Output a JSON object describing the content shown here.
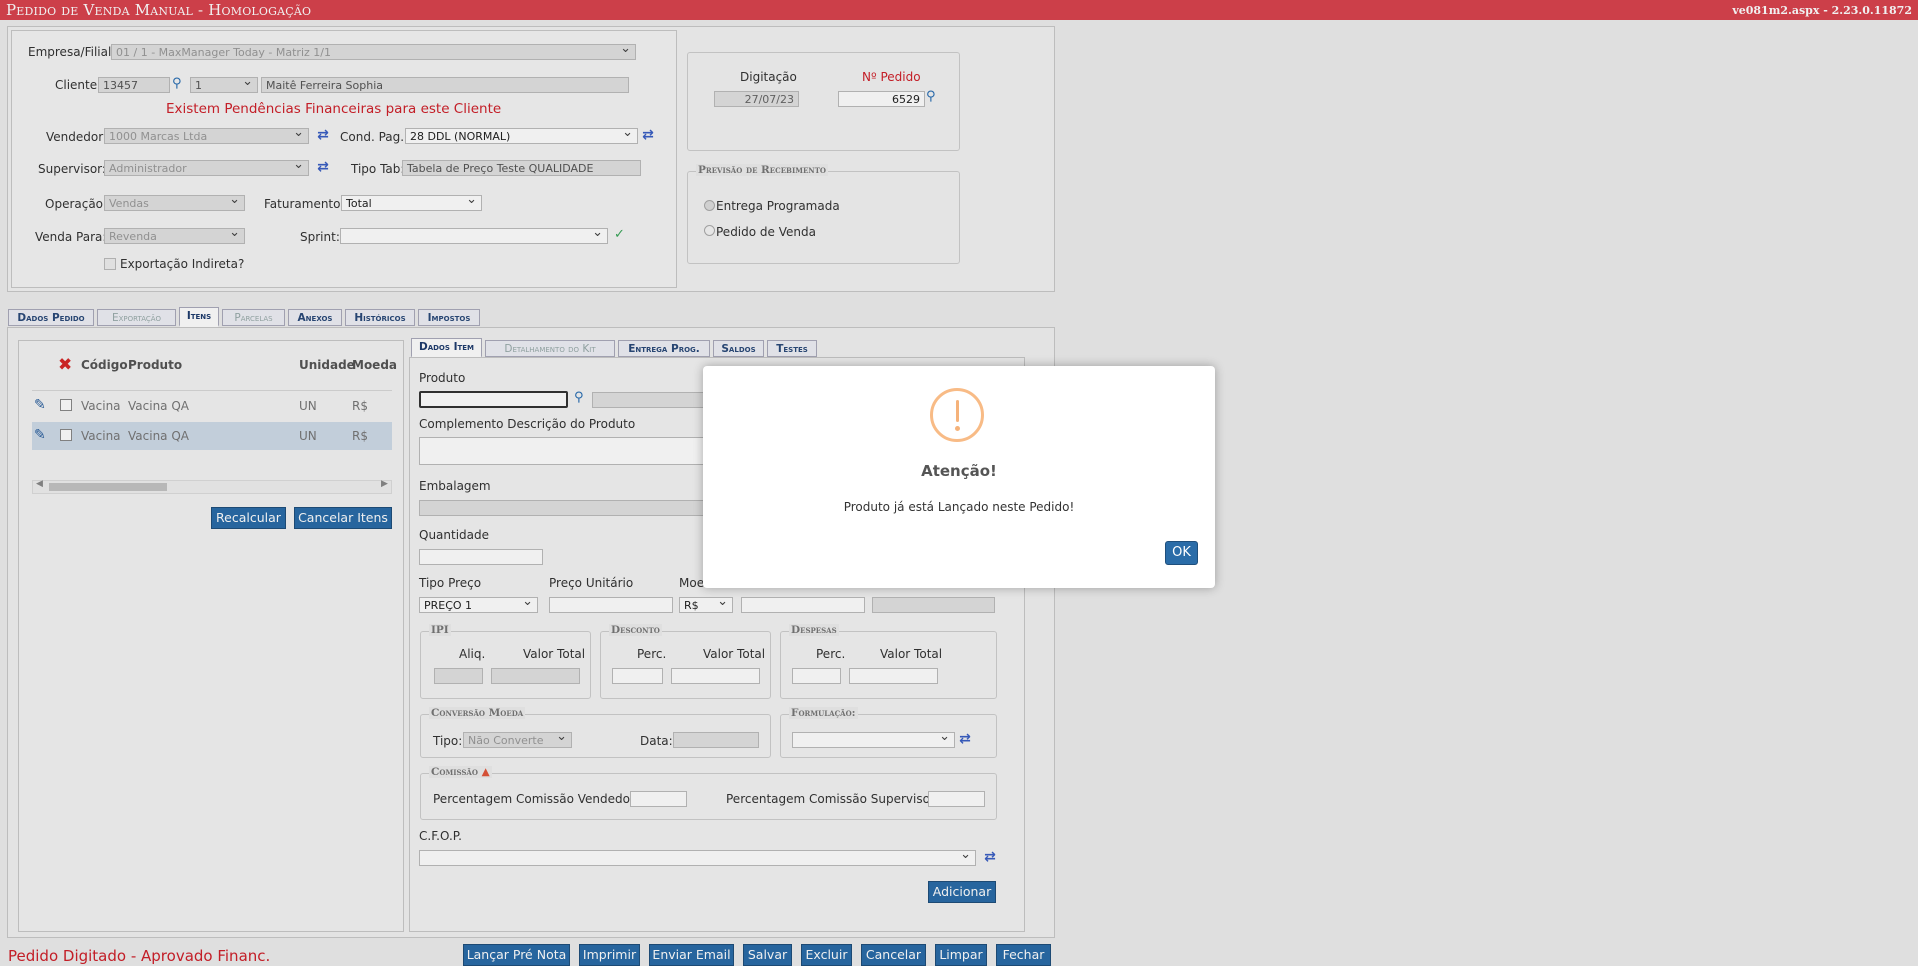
{
  "header": {
    "title": "Pedido de Venda Manual  - Homologação",
    "version": "ve081m2.aspx - 2.23.0.11872"
  },
  "form": {
    "empresa_label": "Empresa/Filial:",
    "empresa_value": "01 / 1 - MaxManager Today - Matriz 1/1",
    "cliente_label": "Cliente:",
    "cliente_code": "13457",
    "cliente_seq": "1",
    "cliente_name": "Maitê Ferreira Sophia",
    "pendencias_msg": "Existem Pendências Financeiras para este Cliente",
    "vendedor_label": "Vendedor:",
    "vendedor_value": "1000 Marcas Ltda",
    "condpag_label": "Cond. Pag.:",
    "condpag_value": "28 DDL (NORMAL)",
    "supervisor_label": "Supervisor:",
    "supervisor_value": "Administrador",
    "tipotab_label": "Tipo Tab:",
    "tipotab_value": "Tabela de Preço Teste QUALIDADE",
    "operacao_label": "Operação:",
    "operacao_value": "Vendas",
    "faturamento_label": "Faturamento:",
    "faturamento_value": "Total",
    "vendapara_label": "Venda Para:",
    "vendapara_value": "Revenda",
    "sprint_label": "Sprint:",
    "sprint_value": "",
    "exportacao_label": "Exportação Indireta?"
  },
  "pedido_box": {
    "digitacao_label": "Digitação",
    "digitacao_value": "27/07/23",
    "npedido_label": "Nº Pedido",
    "npedido_value": "6529"
  },
  "previsao": {
    "legend": "Previsão de Recebimento",
    "opt1": "Entrega Programada",
    "opt2": "Pedido de Venda"
  },
  "main_tabs": [
    "Dados Pedido",
    "Exportação",
    "Itens",
    "Parcelas",
    "Anexos",
    "Históricos",
    "Impostos"
  ],
  "items_table": {
    "headers": [
      "Código",
      "Produto",
      "Unidade",
      "Moeda"
    ],
    "rows": [
      {
        "codigo": "Vacina",
        "produto": "Vacina QA",
        "unidade": "UN",
        "moeda": "R$"
      },
      {
        "codigo": "Vacina",
        "produto": "Vacina QA",
        "unidade": "UN",
        "moeda": "R$"
      }
    ],
    "recalcular": "Recalcular",
    "cancelar_itens": "Cancelar Itens"
  },
  "item_tabs": [
    "Dados Item",
    "Detalhamento do Kit",
    "Entrega Prog.",
    "Saldos",
    "Testes"
  ],
  "item_form": {
    "produto": "Produto",
    "complemento": "Complemento Descrição do Produto",
    "embalagem": "Embalagem",
    "quantidade": "Quantidade",
    "tipo_preco": "Tipo Preço",
    "tipo_preco_value": "PREÇO 1",
    "preco_unitario": "Preço Unitário",
    "moeda": "Moe",
    "moeda_value": "R$",
    "ipi_legend": "IPI",
    "aliq": "Aliq.",
    "valor_total": "Valor Total",
    "desconto_legend": "Desconto",
    "perc": "Perc.",
    "despesas_legend": "Despesas",
    "conversao_legend": "Conversão Moeda",
    "tipo": "Tipo:",
    "tipo_value": "Não Converte",
    "data": "Data:",
    "formulacao_legend": "Formulação:",
    "comissao_legend": "Comissão",
    "perc_vendedor": "Percentagem Comissão Vendedor:",
    "perc_supervisor": "Percentagem Comissão Supervisor:",
    "cfop": "C.F.O.P.",
    "adicionar": "Adicionar"
  },
  "footer": {
    "status": "Pedido Digitado - Aprovado Financ.",
    "buttons": [
      "Lançar Pré Nota",
      "Imprimir",
      "Enviar Email",
      "Salvar",
      "Excluir",
      "Cancelar",
      "Limpar",
      "Fechar"
    ]
  },
  "dialog": {
    "title": "Atenção!",
    "message": "Produto já está Lançado neste Pedido!",
    "ok": "OK"
  },
  "colors": {
    "header_red": "#d9434e",
    "button_blue": "#2a6ca8",
    "warning_orange": "#f8bb86",
    "alert_red": "#d0202a"
  }
}
